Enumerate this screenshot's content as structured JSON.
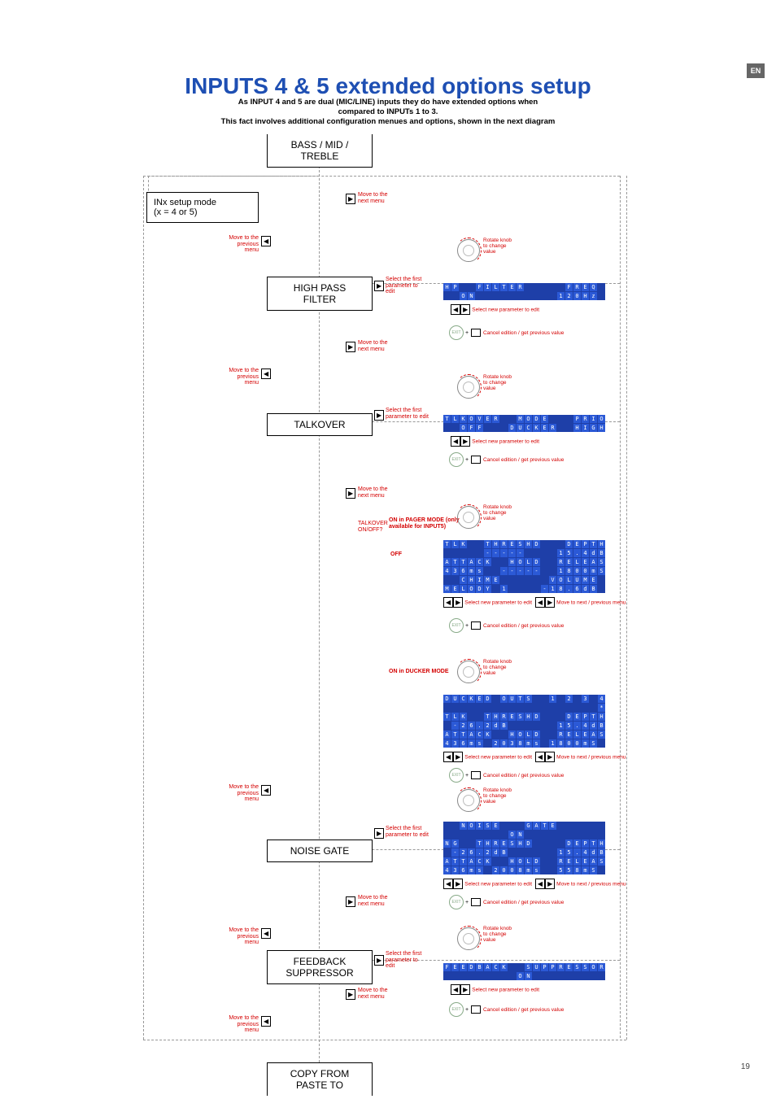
{
  "badge": "EN",
  "pageNumber": "19",
  "title": "INPUTS 4 & 5 extended options setup",
  "subtitle_l1": "As INPUT 4 and 5 are dual (MIC/LINE) inputs they do have extended options when",
  "subtitle_l2": "compared to INPUTs 1 to 3.",
  "subtitle_l3": "This fact involves additional configuration menues and options, shown in the next diagram",
  "nodes": {
    "bass": "BASS / MID /\nTREBLE",
    "inx": "INx setup mode\n(x = 4 or 5)",
    "hpf": "HIGH PASS\nFILTER",
    "talkover": "TALKOVER",
    "noisegate": "NOISE GATE",
    "feedback": "FEEDBACK\nSUPPRESSOR",
    "copy": "COPY FROM\nPASTE TO"
  },
  "labels": {
    "movePrev": "Move to the\nprevious menu",
    "moveNext": "Move to the\nnext menu",
    "selectFirst": "Select the first\nparameter to\nedit",
    "selectFirst2": "Select the first\nparameter to edit",
    "rotateKnob": "Rotate knob\nto change\nvalue",
    "selectNewParam": "Select new\nparameter to edit",
    "cancelEdition": "Cancel edition\n/ get previous\nvalue",
    "moveNextPrevMenu": "Move to next /\nprevious menu",
    "talkoverOnOff": "TALKOVER\nON/OFF?",
    "onPager": "ON in PAGER MODE (only\navailable for INPUT5)",
    "off": "OFF",
    "onDucker": "ON in DUCKER MODE",
    "plus": "+",
    "exit": "EXIT"
  },
  "lcd": {
    "hpf": [
      "HP  FILTER     FREQ ",
      "  ON          120Hz "
    ],
    "tlkover": [
      "TLKOVER  MODE   PRIO",
      "  OFF   DUCKER  HIGH"
    ],
    "pager": [
      "TLK  THRESHD   DEPTH",
      "     -----    15.4dB",
      "ATTACK  HOLD  RELEAS",
      "436ms  -----  1800mS",
      "  CHIME      VOLUME ",
      "MELODY 1    -18.6dB "
    ],
    "ducker": [
      "DUCKED OUTS  1 2 3 4",
      "                   *",
      "TLK  THRESHD   DEPTH",
      " -26.2dB      15.4dB",
      "ATTACK  HOLD  RELEAS",
      "436ms 2038ms 1800mS "
    ],
    "noise": [
      "  NOISE   GATE      ",
      "        ON          ",
      "NG  THRESHD    DEPTH",
      " -26.2dB      15.4dB",
      "ATTACK  HOLD  RELEAS",
      "436ms 2008ms  558mS "
    ],
    "fbk": [
      "FEEDBACK  SUPPRESSOR",
      "         ON         "
    ]
  }
}
